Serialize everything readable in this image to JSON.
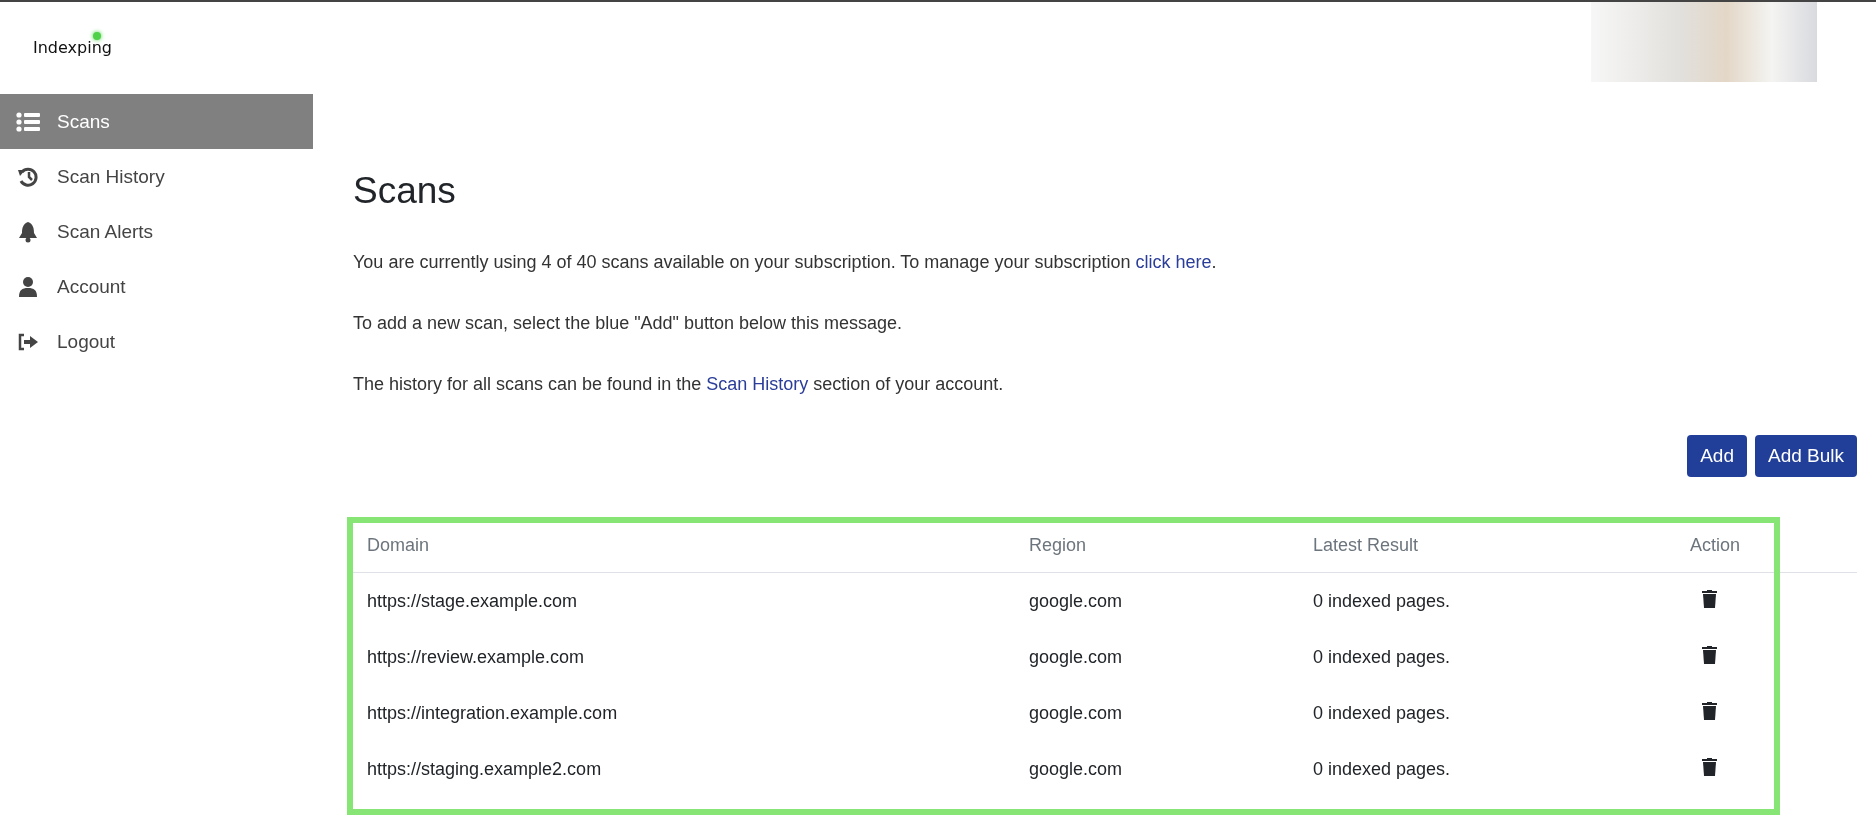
{
  "logo": {
    "text": "Indexping"
  },
  "sidebar": {
    "items": [
      {
        "label": "Scans",
        "selected": true
      },
      {
        "label": "Scan History",
        "selected": false
      },
      {
        "label": "Scan Alerts",
        "selected": false
      },
      {
        "label": "Account",
        "selected": false
      },
      {
        "label": "Logout",
        "selected": false
      }
    ]
  },
  "page": {
    "title": "Scans",
    "paragraphs": [
      {
        "before": "You are currently using 4 of 40 scans available on your subscription. To manage your subscription ",
        "link": "click here",
        "after": "."
      },
      {
        "before": "To add a new scan, select the blue \"Add\" button below this message."
      },
      {
        "before": "The history for all scans can be found in the ",
        "link": "Scan History",
        "after": " section of your account."
      }
    ],
    "buttons": [
      "Add",
      "Add Bulk"
    ]
  },
  "table": {
    "columns": [
      "Domain",
      "Region",
      "Latest Result",
      "Action"
    ],
    "rows": [
      {
        "domain": "https://stage.example.com",
        "region": "google.com",
        "latest_result": "0 indexed pages."
      },
      {
        "domain": "https://review.example.com",
        "region": "google.com",
        "latest_result": "0 indexed pages."
      },
      {
        "domain": "https://integration.example.com",
        "region": "google.com",
        "latest_result": "0 indexed pages."
      },
      {
        "domain": "https://staging.example2.com",
        "region": "google.com",
        "latest_result": "0 indexed pages."
      }
    ]
  }
}
